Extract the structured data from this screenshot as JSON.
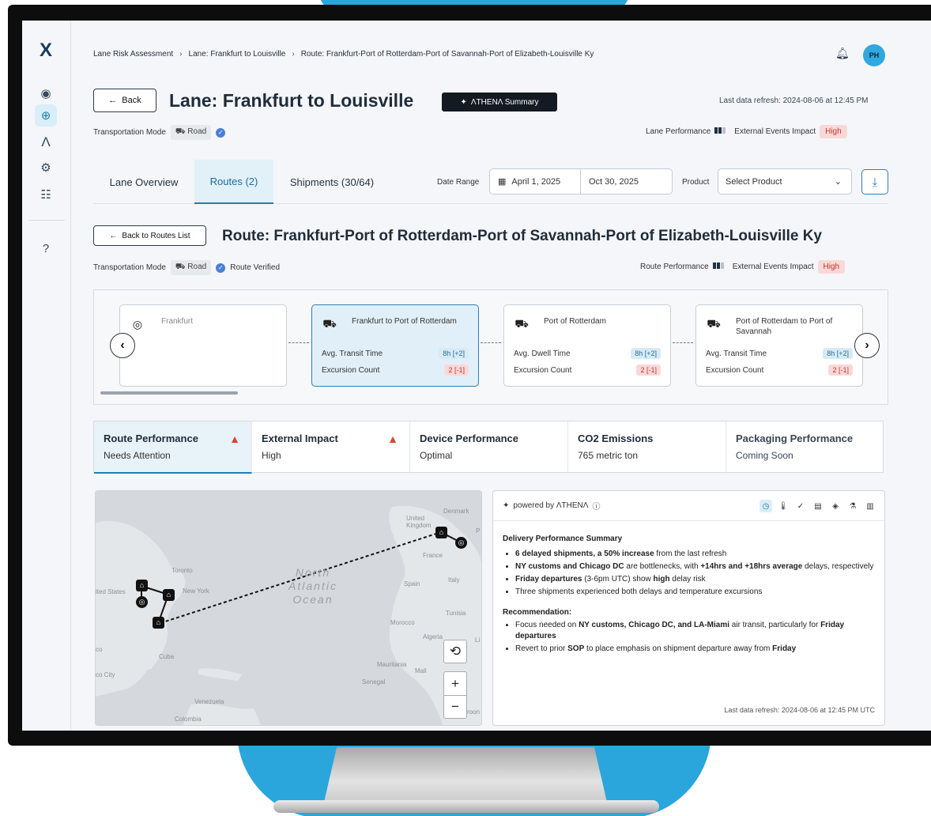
{
  "nav": {
    "logo": "X",
    "icons": [
      "eye-icon",
      "globe-icon",
      "athena-icon",
      "settings-icon",
      "users-icon",
      "help-icon"
    ]
  },
  "breadcrumb": [
    "Lane Risk Assessment",
    "Lane: Frankfurt to Louisville",
    "Route: Frankfurt-Port of Rotterdam-Port of Savannah-Port of Elizabeth-Louisville Ky"
  ],
  "header": {
    "back_label": "Back",
    "title": "Lane: Frankfurt to Louisville",
    "athena_label": "ΛTHENΛ Summary",
    "last_refresh": "Last data refresh: 2024-08-06 at 12:45 PM",
    "avatar": "PH",
    "transport_label": "Transportation Mode",
    "transport_mode": "Road",
    "lane_perf_label": "Lane Performance",
    "ext_events_label": "External Events Impact",
    "ext_events_value": "High"
  },
  "tabs": [
    "Lane Overview",
    "Routes (2)",
    "Shipments (30/64)"
  ],
  "filters": {
    "date_label": "Date Range",
    "date_from": "April 1, 2025",
    "date_to": "Oct 30, 2025",
    "product_label": "Product",
    "product_placeholder": "Select Product"
  },
  "route": {
    "back_label": "Back to Routes List",
    "title": "Route: Frankfurt-Port of Rotterdam-Port of Savannah-Port of Elizabeth-Louisville Ky",
    "transport_label": "Transportation Mode",
    "transport_mode": "Road",
    "verified": "Route Verified",
    "perf_label": "Route Performance",
    "ext_label": "External Events Impact",
    "ext_value": "High"
  },
  "steps": [
    {
      "title": "Frankfurt"
    },
    {
      "title": "Frankfurt to Port of Rotterdam",
      "m1": "Avg. Transit Time",
      "v1": "8h [+2]",
      "m2": "Excursion Count",
      "v2": "2 [-1]"
    },
    {
      "title": "Port of Rotterdam",
      "m1": "Avg. Dwell Time",
      "v1": "8h [+2]",
      "m2": "Excursion Count",
      "v2": "2 [-1]"
    },
    {
      "title": "Port of Rotterdam to Port of Savannah",
      "m1": "Avg. Transit Time",
      "v1": "8h [+2]",
      "m2": "Excursion Count",
      "v2": "2 [-1]"
    }
  ],
  "perf_tabs": [
    {
      "title": "Route Performance",
      "status": "Needs Attention"
    },
    {
      "title": "External Impact",
      "status": "High"
    },
    {
      "title": "Device Performance",
      "status": "Optimal"
    },
    {
      "title": "CO2 Emissions",
      "status": "765 metric ton"
    },
    {
      "title": "Packaging Performance",
      "status": "Coming Soon"
    }
  ],
  "map": {
    "labels": [
      "United Kingdom",
      "Denmark",
      "France",
      "Spain",
      "Italy",
      "Morocco",
      "Tunisia",
      "Algeria",
      "Mauritania",
      "Mali",
      "Senegal",
      "Cuba",
      "Venezuela",
      "Colombia",
      "Toronto",
      "New York",
      "ited States",
      "co City",
      "Li",
      "P",
      "co",
      "N",
      "roon"
    ],
    "ocean": "North Atlantic Ocean"
  },
  "summary": {
    "powered": "powered by ΛTHENΛ",
    "heading": "Delivery Performance Summary",
    "bullets": [
      [
        "6 delayed shipments, a 50% increase",
        " from the last refresh"
      ],
      [
        "NY customs and Chicago DC",
        " are bottlenecks, with ",
        "+14hrs and +18hrs average",
        " delays, respectively"
      ],
      [
        "Friday departures",
        " (3-6pm UTC) show ",
        "high",
        " delay risk"
      ],
      [
        "",
        "Three shipments experienced both delays and temperature excursions"
      ]
    ],
    "rec_heading": "Recommendation",
    "rec": [
      [
        "",
        "Focus needed on ",
        "NY customs, Chicago DC, and LA-Miami",
        " air transit, particularly for ",
        "Friday departures"
      ],
      [
        "",
        "Revert to prior ",
        "SOP",
        " to place emphasis on shipment departure away from ",
        "Friday"
      ]
    ],
    "footer": "Last data refresh: 2024-08-06 at 12:45 PM UTC"
  },
  "colors": {
    "accent": "#1f7fb1",
    "danger": "#d9463a",
    "monitor_blue": "#2aa6dd"
  }
}
